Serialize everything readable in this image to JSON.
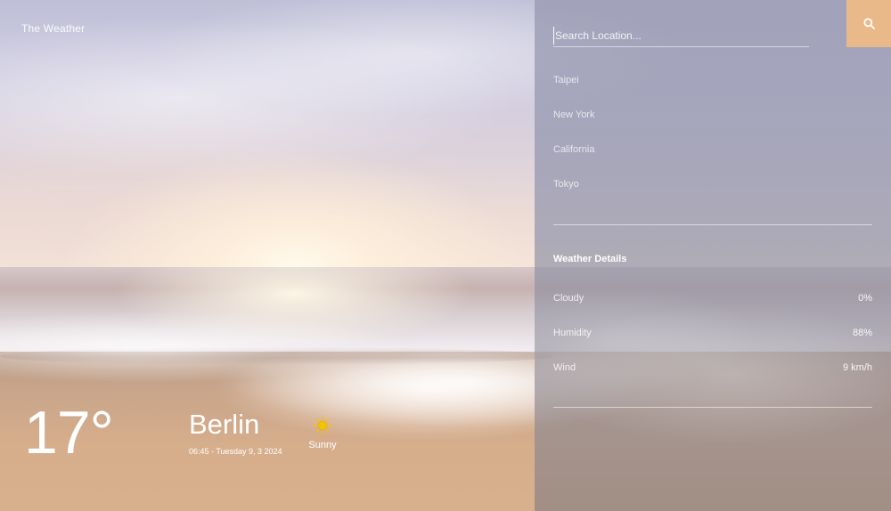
{
  "app": {
    "title": "The Weather"
  },
  "current": {
    "temperature": "17°",
    "city": "Berlin",
    "datetime": "06:45 - Tuesday 9, 3 2024",
    "condition": "Sunny",
    "condition_icon": "sun-icon"
  },
  "search": {
    "placeholder": "Search Location...",
    "value": "",
    "button_icon": "search-icon"
  },
  "locations": [
    {
      "label": "Taipei"
    },
    {
      "label": "New York"
    },
    {
      "label": "California"
    },
    {
      "label": "Tokyo"
    }
  ],
  "details": {
    "title": "Weather Details",
    "rows": [
      {
        "label": "Cloudy",
        "value": "0%"
      },
      {
        "label": "Humidity",
        "value": "88%"
      },
      {
        "label": "Wind",
        "value": "9 km/h"
      }
    ]
  },
  "colors": {
    "accent": "#e9b98a",
    "text": "#ffffff",
    "sun": "#f5c400"
  }
}
